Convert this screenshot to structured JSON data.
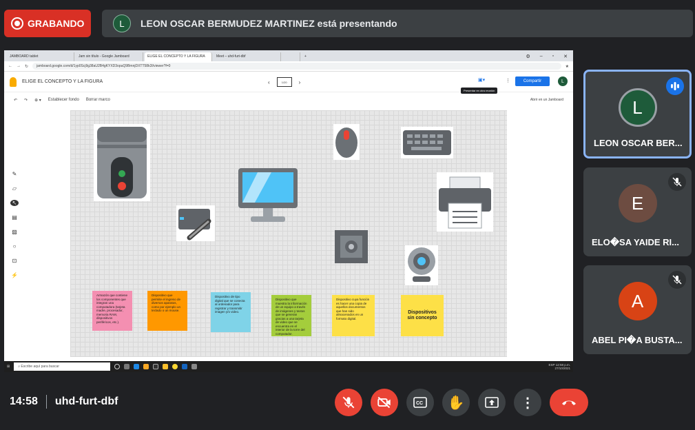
{
  "recording": {
    "label": "GRABANDO"
  },
  "presenter": {
    "initial": "L",
    "text": "LEON OSCAR BERMUDEZ MARTINEZ está presentando"
  },
  "browser": {
    "tabs": [
      "JAMBOARD tablet",
      "Jam sin título - Google Jamboard",
      "ELIGE EL CONCEPTO Y LA FIGURA",
      "Meet – uhd-furt-dbf",
      "",
      ""
    ],
    "url": "jamboard.google.com/d/1yp0Scj9g38aU2B4gKYXD3opuQ9BmnjDXTT58k3I/viewer?f=0"
  },
  "jamboard": {
    "title": "ELIGE EL CONCEPTO Y LA FIGURA",
    "frame_label": "1/20",
    "tooltip": "Presentar en otra reunión",
    "share": "Compartir",
    "user_initial": "L",
    "set_background": "Establecer fondo",
    "clear_frame": "Borrar marco",
    "open_jamboard": "Abrir en un Jamboard",
    "notes": [
      {
        "text": "Armazón que contiene los componentes que integran una computadora (tarjeta madre, procesador, memoria RAM, dispositivos periféricos, etc.).",
        "color": "#f48fb1"
      },
      {
        "text": "Dispositivo que permite el ingreso de diversos aparatos, como por ejemplo un teclado o un mouse.",
        "color": "#ff9800"
      },
      {
        "text": "Dispositivo de tipo digital que se conecta al ordenador para registrar y transmitir imagen y/o video.",
        "color": "#7fd3e8"
      },
      {
        "text": "Dispositivo que muestra la información de un equipo a través de imágenes y textos que se generan gracias a una tarjeta de video que se encuentra en el interior de la torre del computador.",
        "color": "#a4cd3c"
      },
      {
        "text": "Dispositivo cuya función es hacer una copia de aquellos documentos que han sido almacenados en un formato digital.",
        "color": "#fde047"
      },
      {
        "text": "Dispositivos sin concepto",
        "color": "#fde047"
      }
    ]
  },
  "taskbar": {
    "search": "Escribe aquí para buscar",
    "time": "12:58 p.m.",
    "date": "27/10/2021",
    "lang": "ESP"
  },
  "participants": [
    {
      "initial": "L",
      "name": "LEON OSCAR BER...",
      "color": "#1e5b3a"
    },
    {
      "initial": "E",
      "name": "ELO�SA YAIDE RI...",
      "color": "#6d4c41"
    },
    {
      "initial": "A",
      "name": "ABEL PI�A BUSTA...",
      "color": "#d84315"
    }
  ],
  "meeting": {
    "time": "14:58",
    "code": "uhd-furt-dbf"
  },
  "colors": {
    "accent": "#1a73e8",
    "danger": "#ea4335",
    "panel": "#3c4043"
  }
}
